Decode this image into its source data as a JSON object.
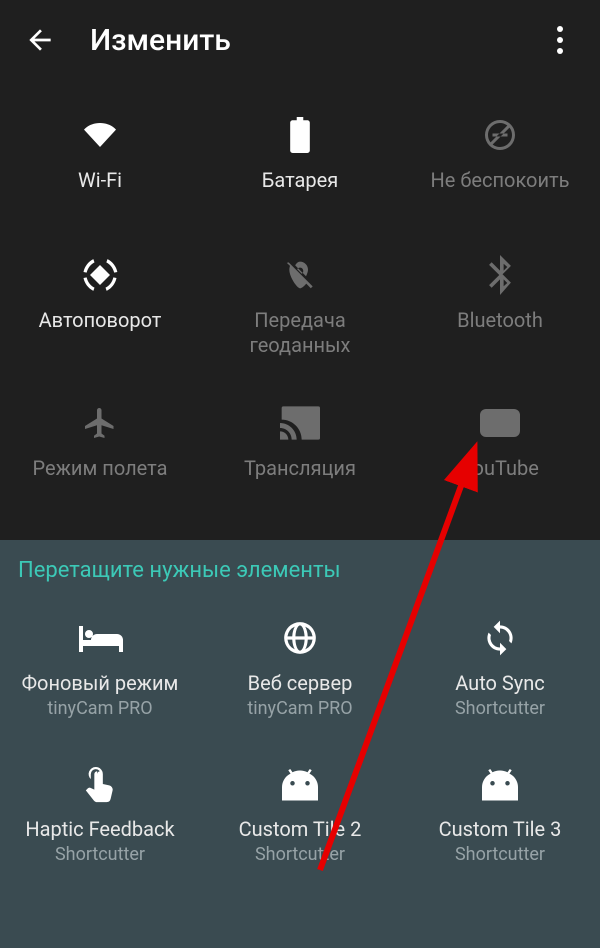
{
  "header": {
    "title": "Изменить"
  },
  "tiles": {
    "wifi": "Wi-Fi",
    "battery": "Батарея",
    "dnd": "Не беспокоить",
    "rotate": "Автоповорот",
    "location": "Передача геоданных",
    "bluetooth": "Bluetooth",
    "airplane": "Режим полета",
    "cast": "Трансляция",
    "youtube": "YouTube"
  },
  "drag": {
    "title": "Перетащите нужные элементы",
    "tiles": {
      "bg": {
        "label": "Фоновый режим",
        "sub": "tinyCam PRO"
      },
      "web": {
        "label": "Веб сервер",
        "sub": "tinyCam PRO"
      },
      "sync": {
        "label": "Auto Sync",
        "sub": "Shortcutter"
      },
      "haptic": {
        "label": "Haptic Feedback",
        "sub": "Shortcutter"
      },
      "ct2": {
        "label": "Custom Tile 2",
        "sub": "Shortcutter"
      },
      "ct3": {
        "label": "Custom Tile 3",
        "sub": "Shortcutter"
      }
    }
  }
}
